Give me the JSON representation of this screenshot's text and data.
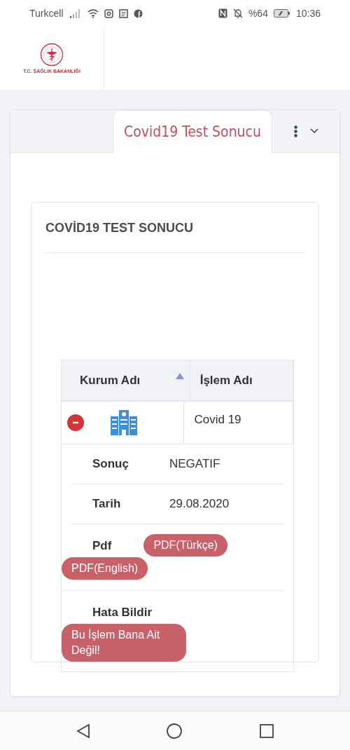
{
  "status_bar": {
    "carrier": "Turkcell",
    "battery": "%64",
    "time": "10:36"
  },
  "header": {
    "logo_text": "T.C. SAĞLIK BAKANLIĞI"
  },
  "tabs": [
    {
      "label": "Covid19 Test Sonucu",
      "selected": true
    }
  ],
  "card": {
    "title": "COVİD19 TEST SONUCU"
  },
  "table": {
    "columns": [
      {
        "label": "Kurum Adı",
        "sorted": true
      },
      {
        "label": "İşlem Adı",
        "sorted": false
      }
    ],
    "rows": [
      {
        "islem": "Covid 19",
        "expanded": true,
        "details": [
          {
            "kind": "text",
            "label": "Sonuç",
            "value": "NEGATIF"
          },
          {
            "kind": "text",
            "label": "Tarih",
            "value": "29.08.2020"
          },
          {
            "kind": "buttons",
            "label": "Pdf",
            "buttons": [
              "PDF(Türkçe)",
              "PDF(English)"
            ]
          },
          {
            "kind": "buttons",
            "label": "Hata Bildir",
            "buttons": [
              "Bu İşlem Bana Ait Değil!"
            ]
          }
        ]
      }
    ]
  }
}
